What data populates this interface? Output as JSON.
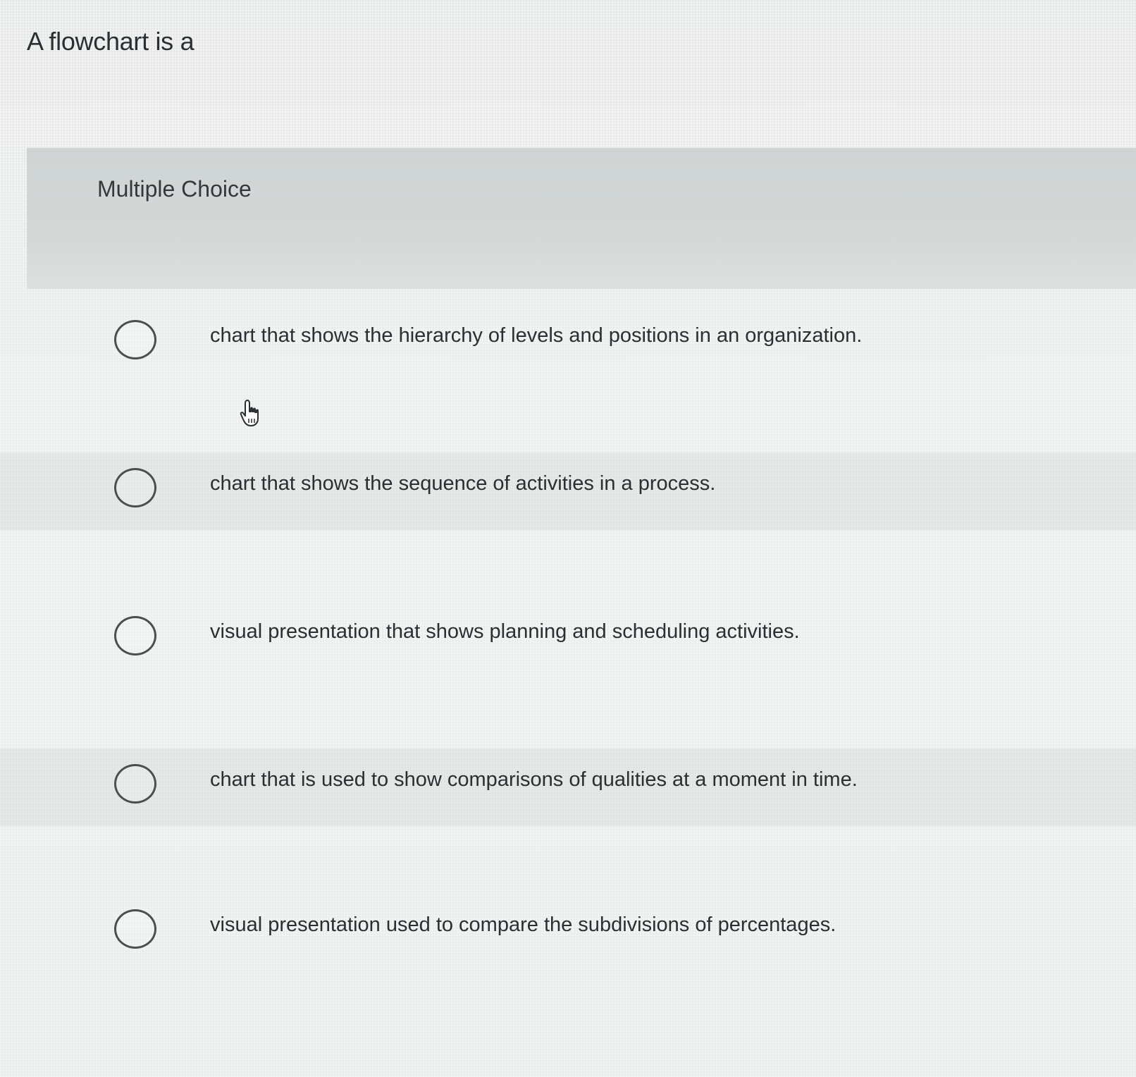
{
  "question": {
    "prompt": "A flowchart is a"
  },
  "mc": {
    "label": "Multiple Choice"
  },
  "options": [
    {
      "text": "chart that shows the hierarchy of levels and positions in an organization."
    },
    {
      "text": "chart that shows the sequence of activities in a process."
    },
    {
      "text": "visual presentation that shows planning and scheduling activities."
    },
    {
      "text": "chart that is used to show comparisons of qualities at a moment in time."
    },
    {
      "text": "visual presentation used to compare the subdivisions of percentages."
    }
  ],
  "icons": {
    "radio": "radio-button-icon",
    "cursor": "hand-pointer-icon"
  },
  "colors": {
    "background": "#e7eae9",
    "header_band": "#d3d8d7",
    "text": "#2b2f33",
    "radio_border": "#4a4f52"
  }
}
